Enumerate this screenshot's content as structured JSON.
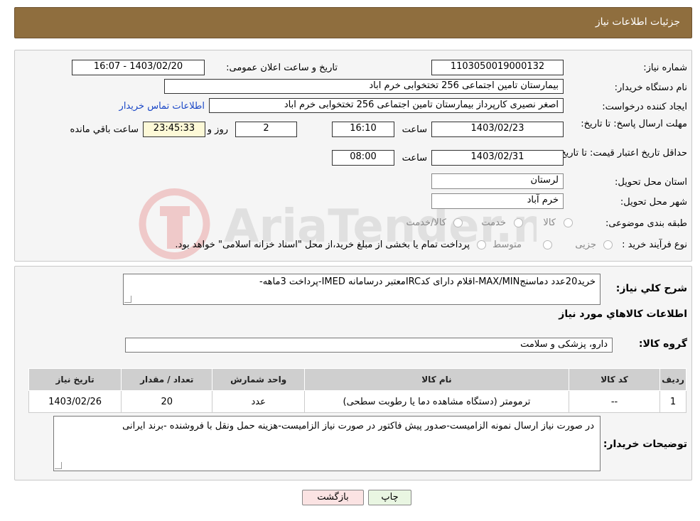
{
  "header": {
    "title": "جزئیات اطلاعات نیاز"
  },
  "form": {
    "need_number_label": "شماره نیاز:",
    "need_number": "1103050019000132",
    "announce_label": "تاریخ و ساعت اعلان عمومی:",
    "announce_value": "1403/02/20 - 16:07",
    "buyer_org_label": "نام دستگاه خریدار:",
    "buyer_org": "بیمارستان تامین اجتماعی  256 تختخوابی خرم اباد",
    "requester_label": "ایجاد کننده درخواست:",
    "requester": "اصغر نصیری کارپرداز بیمارستان تامین اجتماعی  256 تختخوابی خرم اباد",
    "contact_link": "اطلاعات تماس خریدار",
    "reply_deadline_label": "مهلت ارسال پاسخ: تا تاریخ:",
    "reply_date": "1403/02/23",
    "time_label": "ساعت",
    "reply_time": "16:10",
    "days_value": "2",
    "days_label": "روز و",
    "remaining_time": "23:45:33",
    "remaining_label": "ساعت باقي مانده",
    "price_validity_label": "حداقل تاریخ اعتبار قیمت: تا تاریخ:",
    "price_date": "1403/02/31",
    "price_time": "08:00",
    "province_label": "استان محل تحویل:",
    "province": "لرستان",
    "city_label": "شهر محل تحویل:",
    "city": "خرم آباد",
    "category_label": "طبقه بندی موضوعی:",
    "category_options": [
      "کالا",
      "خدمت",
      "کالا/خدمت"
    ],
    "process_label": "نوع فرآیند خرید :",
    "process_options": [
      "جزیی",
      "متوسط"
    ],
    "process_note": "پرداخت تمام یا بخشی از مبلغ خرید،از محل \"اسناد خزانه اسلامی\" خواهد بود."
  },
  "summary": {
    "description_label": "شرح کلي نياز:",
    "description": "خرید20عدد دماسنجMAX/MIN-اقلام دارای کدIRCمعتبر درسامانه IMED-پرداخت 3ماهه-",
    "goods_info_title": "اطلاعات کالاهاي مورد نياز",
    "goods_group_label": "گروه کالا:",
    "goods_group": "دارو، پزشکی و سلامت"
  },
  "table": {
    "headers": [
      "ردیف",
      "کد کالا",
      "نام کالا",
      "واحد شمارش",
      "تعداد / مقدار",
      "تاریخ نیاز"
    ],
    "rows": [
      [
        "1",
        "--",
        "ترمومتر (دستگاه مشاهده دما یا رطوبت سطحی)",
        "عدد",
        "20",
        "1403/02/26"
      ]
    ]
  },
  "notes": {
    "label": "توضیحات خریدار:",
    "text": "در صورت نیاز ارسال نمونه الزامیست-صدور پیش فاکتور در صورت نیاز الزامیست-هزینه حمل ونقل با فروشنده -برند ایرانی"
  },
  "buttons": {
    "print": "چاپ",
    "back": "بازگشت"
  },
  "watermark": {
    "text": "AriaTender.neT"
  },
  "colors": {
    "header_bg": "#8f6e3e",
    "link": "#1a47c7",
    "back_button_bg": "#fbe3e3",
    "print_button_bg": "#e9f6e2"
  }
}
